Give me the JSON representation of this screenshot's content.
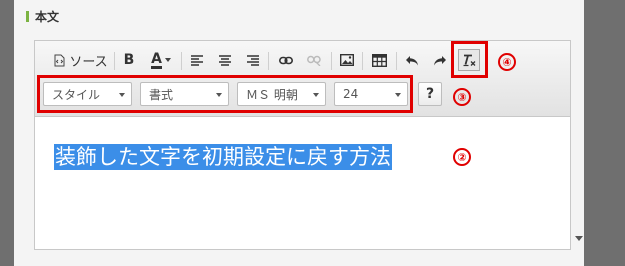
{
  "section": {
    "title": "本文"
  },
  "toolbar": {
    "source_label": "ソース",
    "bold_label": "B",
    "text_color_label": "A",
    "help_label": "?"
  },
  "format_bar": {
    "style_label": "スタイル",
    "format_label": "書式",
    "font_label": "ＭＳ 明朝",
    "size_label": "24"
  },
  "editor": {
    "content_text": "装飾した文字を初期設定に戻す方法"
  },
  "callouts": {
    "c2": "②",
    "c3": "③",
    "c4": "④"
  },
  "colors": {
    "highlight": "#3b8ee8",
    "callout": "#e00000",
    "section_bar": "#7cb342"
  },
  "icons": [
    "source-icon",
    "bold-icon",
    "text-color-icon",
    "align-left-icon",
    "align-center-icon",
    "align-right-icon",
    "link-icon",
    "unlink-icon",
    "image-icon",
    "table-icon",
    "undo-icon",
    "redo-icon",
    "remove-format-icon"
  ]
}
